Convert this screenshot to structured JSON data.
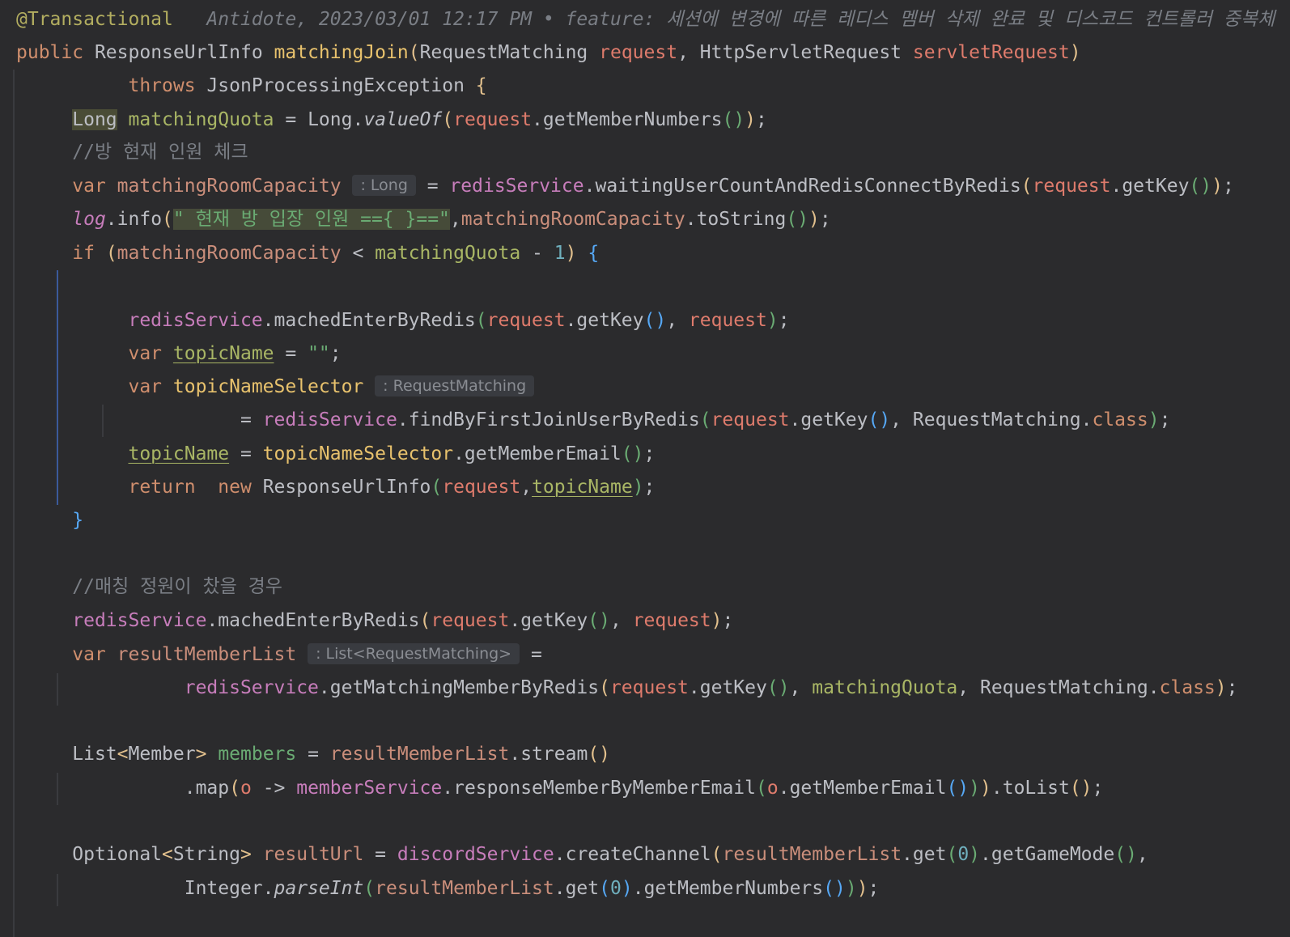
{
  "blame": {
    "annotation": "@Transactional",
    "text": "Antidote, 2023/03/01 12:17 PM • feature: 세션에 변경에 따른 레디스 멤버 삭제 완료 및 디스코드 컨트롤러 중복체"
  },
  "code": {
    "l1_public": "public",
    "l1_type": "ResponseUrlInfo",
    "l1_method": "matchingJoin",
    "l1_ptype1": "RequestMatching",
    "l1_pname1": "request",
    "l1_ptype2": "HttpServletRequest",
    "l1_pname2": "servletRequest",
    "l2_throws": "throws",
    "l2_exc": "JsonProcessingException",
    "l3_long": "Long",
    "l3_var": "matchingQuota",
    "l3_valueOf": "valueOf",
    "l3_call": "getMemberNumbers",
    "c1": "//방 현재 인원 체크",
    "l5_var": "matchingRoomCapacity",
    "l5_hint": ": Long",
    "l5_call": "waitingUserCountAndRedisConnectByRedis",
    "l6_log": "log",
    "l6_info": "info",
    "l6_str": "\" 현재 방 입장 인원 =={ }==\"",
    "l6_tostr": "toString",
    "l7_if": "if",
    "l7_num": "1",
    "l9_call": "machedEnterByRedis",
    "l10_var": "topicName",
    "l10_str": "\"\"",
    "l11_var": "topicNameSelector",
    "l11_hint": ": RequestMatching",
    "l12_call": "findByFirstJoinUserByRedis",
    "l13_call": "getMemberEmail",
    "l14_return": "return",
    "l14_new": "new",
    "c2": "//매칭 정원이 찼을 경우",
    "l19_var": "resultMemberList",
    "l19_hint": ": List<RequestMatching>",
    "l20_call": "getMatchingMemberByRedis",
    "l22_list": "List",
    "l22_member": "Member",
    "l22_var": "members",
    "l22_stream": "stream",
    "l23_map": "map",
    "l23_o": "o",
    "l23_service": "memberService",
    "l23_call": "responseMemberByMemberEmail",
    "l23_tolist": "toList",
    "l25_optional": "Optional",
    "l25_string": "String",
    "l25_var": "resultUrl",
    "l25_service": "discordService",
    "l25_call": "createChannel",
    "l25_get": "get",
    "l25_zero": "0",
    "l25_mode": "getGameMode",
    "l26_integer": "Integer",
    "l26_parse": "parseInt",
    "redisService": "redisService",
    "request": "request",
    "getKey": "getKey",
    "class_kw": "class",
    "var_kw": "var",
    "long_cls": "Long"
  }
}
